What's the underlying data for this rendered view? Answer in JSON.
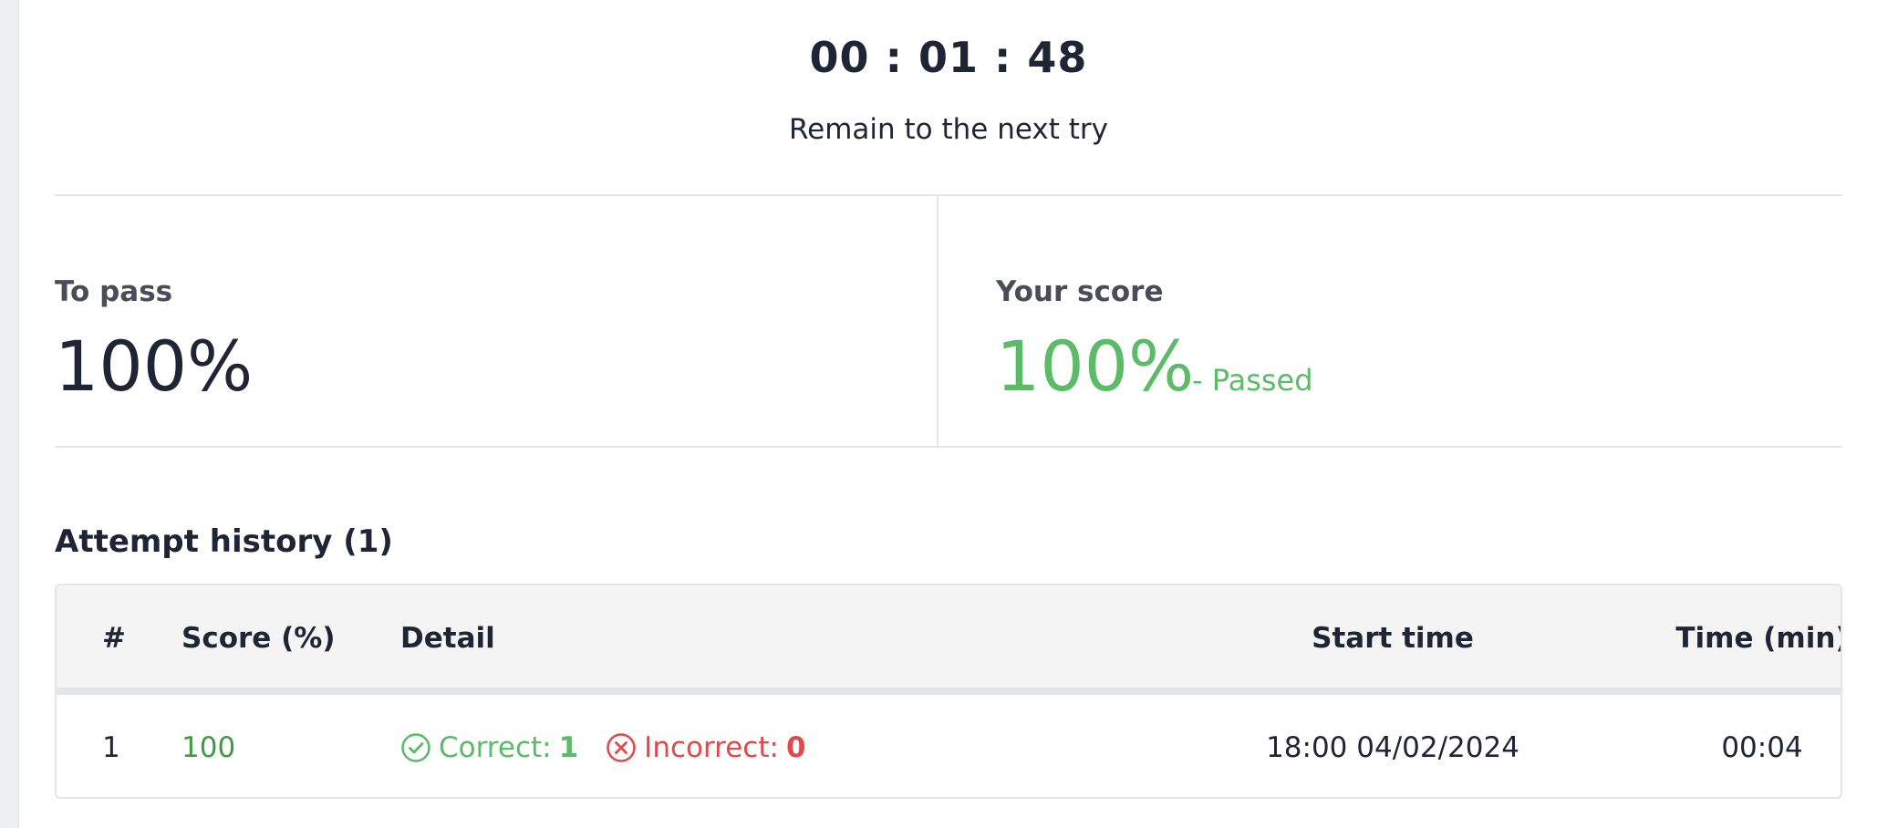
{
  "timer": {
    "value": "00 : 01 : 48",
    "caption": "Remain to the next try"
  },
  "summary": {
    "to_pass_label": "To pass",
    "to_pass_value": "100%",
    "score_label": "Your score",
    "score_value": "100%",
    "score_status": "- Passed"
  },
  "history": {
    "title": "Attempt history (1)",
    "columns": [
      "#",
      "Score (%)",
      "Detail",
      "Start time",
      "Time (min)"
    ],
    "rows": [
      {
        "num": "1",
        "score": "100",
        "correct_label": "Correct:",
        "correct_count": "1",
        "incorrect_label": "Incorrect:",
        "incorrect_count": "0",
        "start_time": "18:00 04/02/2024",
        "duration": "00:04"
      }
    ]
  },
  "colors": {
    "pass_green": "#5bbb66",
    "score_green": "#3e9a43",
    "incorrect_red": "#e04a4a",
    "text_dark": "#1e2535"
  },
  "icons": [
    "check-circle-icon",
    "x-circle-icon"
  ]
}
